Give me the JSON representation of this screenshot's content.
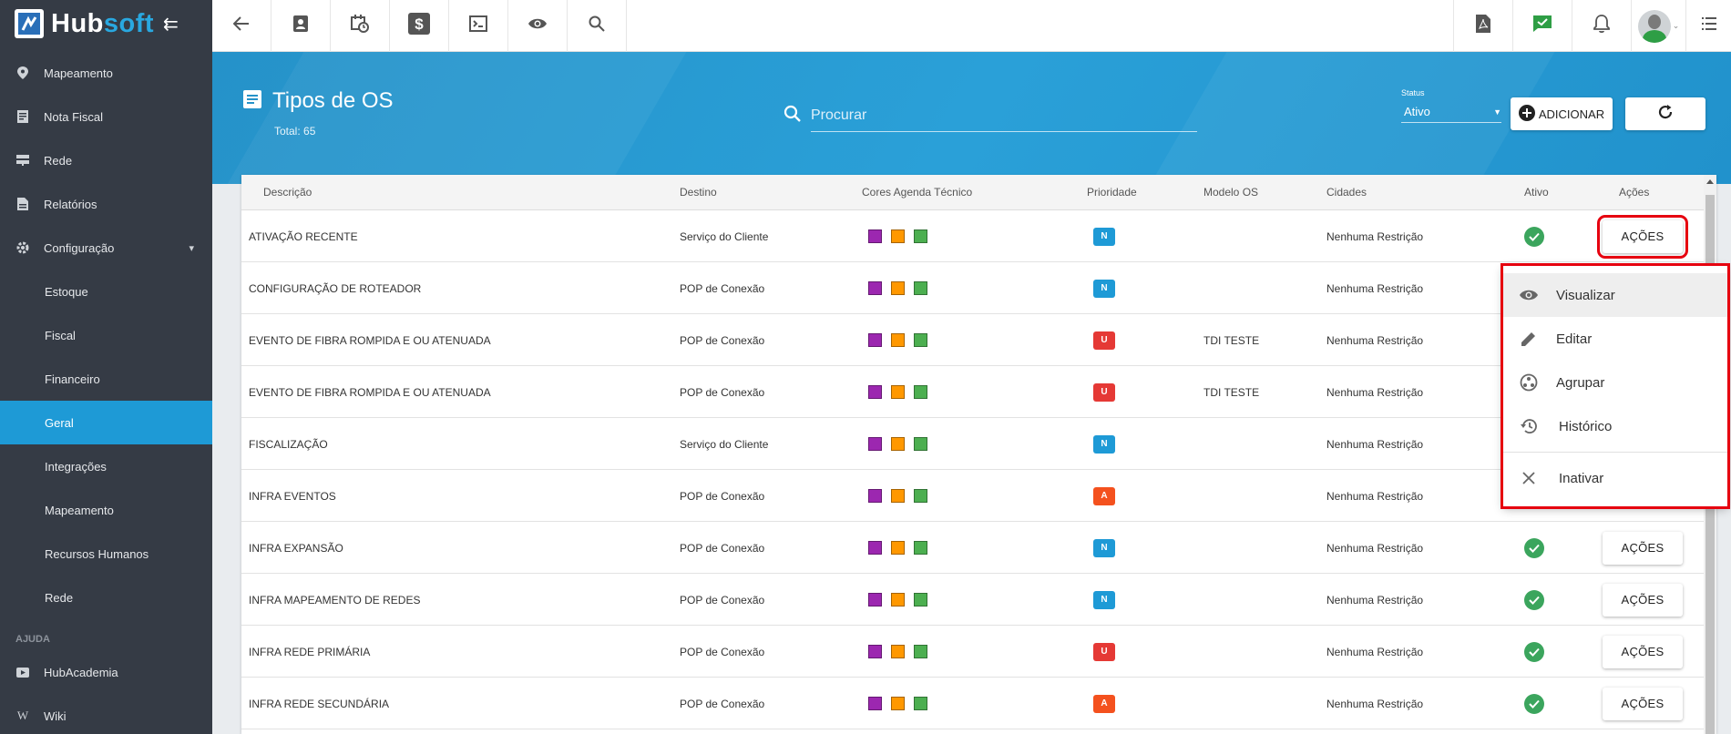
{
  "brand": {
    "name_part1": "Hub",
    "name_part2": "soft"
  },
  "sidebar": {
    "items": [
      {
        "label": "Mapeamento",
        "icon": "map-pin-icon"
      },
      {
        "label": "Nota Fiscal",
        "icon": "receipt-icon"
      },
      {
        "label": "Rede",
        "icon": "server-icon"
      },
      {
        "label": "Relatórios",
        "icon": "report-icon"
      },
      {
        "label": "Configuração",
        "icon": "gear-icon",
        "expanded": true
      }
    ],
    "sub_items": [
      {
        "label": "Estoque"
      },
      {
        "label": "Fiscal"
      },
      {
        "label": "Financeiro"
      },
      {
        "label": "Geral",
        "active": true
      },
      {
        "label": "Integrações"
      },
      {
        "label": "Mapeamento"
      },
      {
        "label": "Recursos Humanos"
      },
      {
        "label": "Rede"
      }
    ],
    "section_help": "AJUDA",
    "help_items": [
      {
        "label": "HubAcademia",
        "icon": "youtube-icon"
      },
      {
        "label": "Wiki",
        "icon": "wikipedia-icon"
      }
    ]
  },
  "topbar": {
    "left_icons": [
      "back-arrow-icon",
      "contact-card-icon",
      "calendar-clock-icon",
      "dollar-icon",
      "terminal-icon",
      "eye-icon",
      "search-icon"
    ],
    "right_icons": [
      "pdf-icon",
      "chat-check-icon",
      "bell-icon"
    ]
  },
  "header": {
    "title": "Tipos de OS",
    "total": "Total: 65",
    "search_placeholder": "Procurar",
    "status_label": "Status",
    "status_value": "Ativo",
    "add_label": "ADICIONAR"
  },
  "table": {
    "columns": [
      "Descrição",
      "Destino",
      "Cores Agenda Técnico",
      "Prioridade",
      "Modelo OS",
      "Cidades",
      "Ativo",
      "Ações"
    ],
    "swatch_colors": [
      "#9c27b0",
      "#ff9800",
      "#4caf50"
    ],
    "priority_colors": {
      "N": "#1e9ad6",
      "U": "#e53935",
      "A": "#f4511e"
    },
    "action_label": "AÇÕES",
    "rows": [
      {
        "desc": "ATIVAÇÃO RECENTE",
        "dest": "Serviço do Cliente",
        "prio": "N",
        "model": "",
        "city": "Nenhuma Restrição"
      },
      {
        "desc": "CONFIGURAÇÃO DE ROTEADOR",
        "dest": "POP de Conexão",
        "prio": "N",
        "model": "",
        "city": "Nenhuma Restrição"
      },
      {
        "desc": "EVENTO DE FIBRA ROMPIDA E OU ATENUADA",
        "dest": "POP de Conexão",
        "prio": "U",
        "model": "TDI TESTE",
        "city": "Nenhuma Restrição"
      },
      {
        "desc": "EVENTO DE FIBRA ROMPIDA E OU ATENUADA",
        "dest": "POP de Conexão",
        "prio": "U",
        "model": "TDI TESTE",
        "city": "Nenhuma Restrição"
      },
      {
        "desc": "FISCALIZAÇÃO",
        "dest": "Serviço do Cliente",
        "prio": "N",
        "model": "",
        "city": "Nenhuma Restrição"
      },
      {
        "desc": "INFRA EVENTOS",
        "dest": "POP de Conexão",
        "prio": "A",
        "model": "",
        "city": "Nenhuma Restrição"
      },
      {
        "desc": "INFRA EXPANSÃO",
        "dest": "POP de Conexão",
        "prio": "N",
        "model": "",
        "city": "Nenhuma Restrição"
      },
      {
        "desc": "INFRA MAPEAMENTO DE REDES",
        "dest": "POP de Conexão",
        "prio": "N",
        "model": "",
        "city": "Nenhuma Restrição"
      },
      {
        "desc": "INFRA REDE PRIMÁRIA",
        "dest": "POP de Conexão",
        "prio": "U",
        "model": "",
        "city": "Nenhuma Restrição"
      },
      {
        "desc": "INFRA REDE SECUNDÁRIA",
        "dest": "POP de Conexão",
        "prio": "A",
        "model": "",
        "city": "Nenhuma Restrição"
      }
    ]
  },
  "menu": {
    "items": [
      {
        "label": "Visualizar",
        "icon": "eye-icon"
      },
      {
        "label": "Editar",
        "icon": "pencil-icon"
      },
      {
        "label": "Agrupar",
        "icon": "group-icon"
      },
      {
        "label": "Histórico",
        "icon": "history-icon"
      },
      {
        "label": "Inativar",
        "icon": "close-icon"
      }
    ]
  }
}
